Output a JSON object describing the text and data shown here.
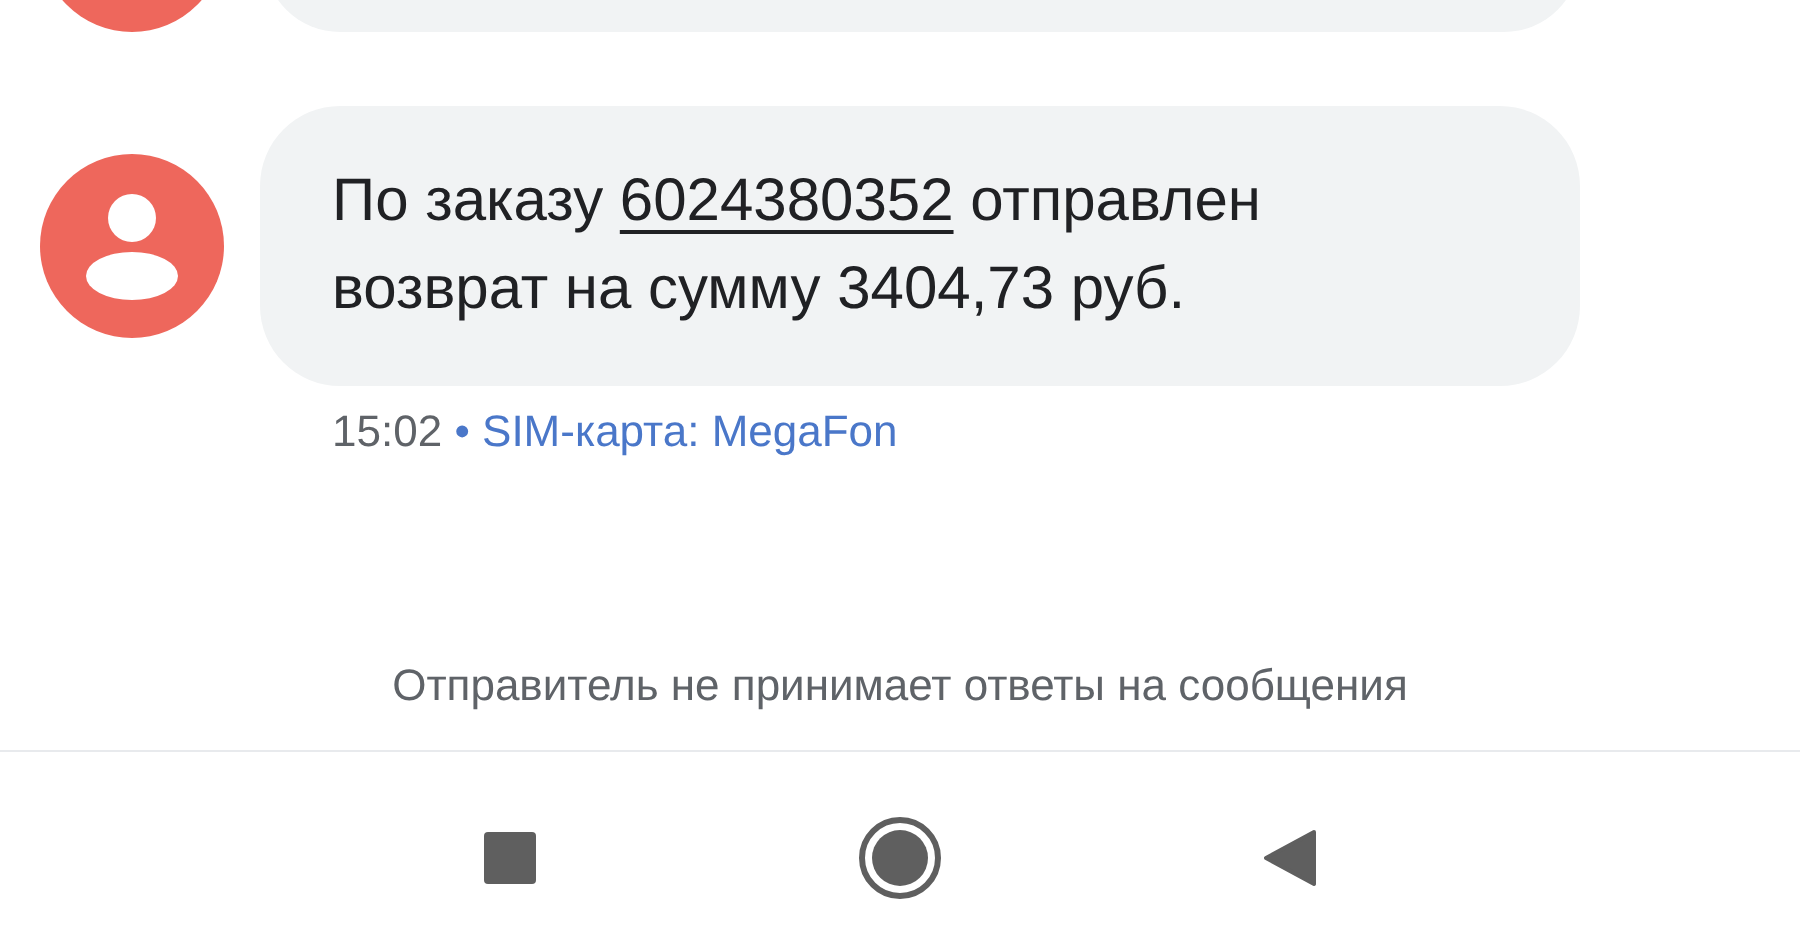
{
  "message": {
    "text_before": "По заказу ",
    "order_link": "6024380352",
    "text_after": " отправлен возврат на сумму 3404,73 руб.",
    "time": "15:02",
    "separator": "•",
    "sim": "SIM-карта: MegaFon"
  },
  "notice": "Отправитель не принимает ответы на сообщения",
  "nav_buttons": [
    {
      "kind": "recents"
    },
    {
      "kind": "home"
    },
    {
      "kind": "back"
    }
  ]
}
